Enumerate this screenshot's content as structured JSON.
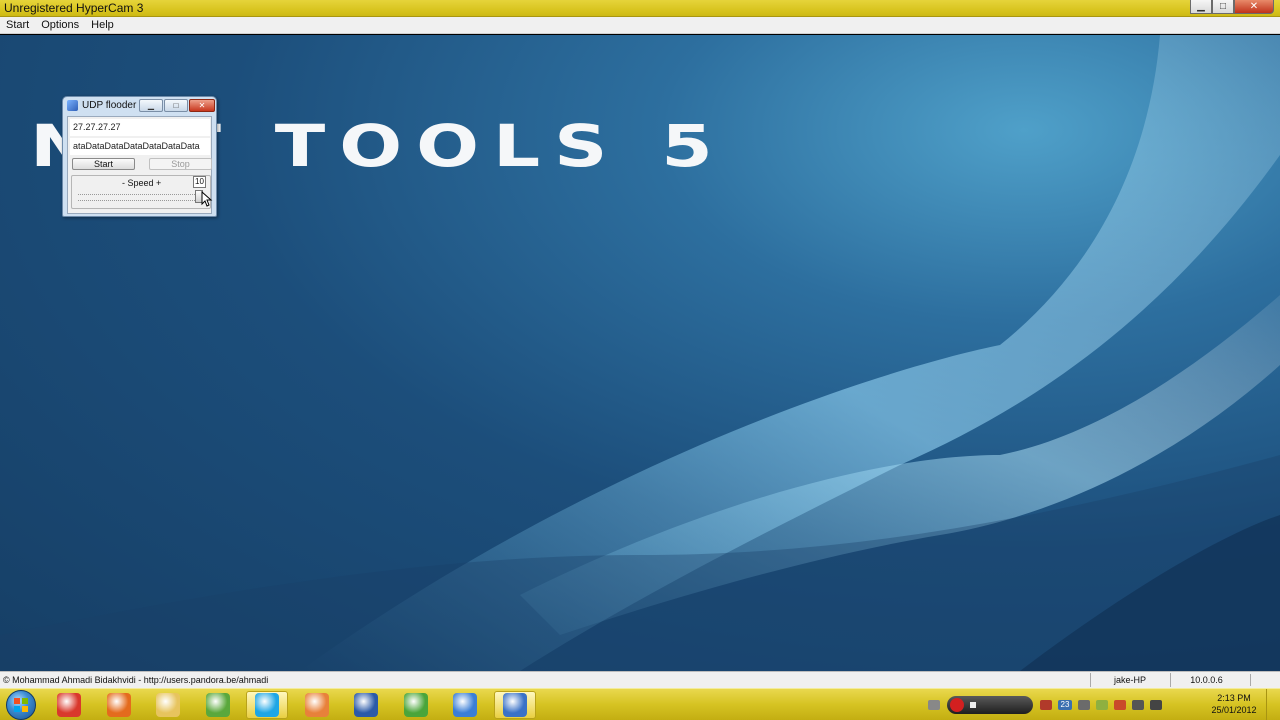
{
  "window": {
    "title": "Unregistered HyperCam 3"
  },
  "menu": {
    "items": [
      "Start",
      "Options",
      "Help"
    ]
  },
  "desktop": {
    "wallpaper_text": "NET TOOLS 5"
  },
  "udp_window": {
    "title": "UDP flooder",
    "ip_value": "27.27.27.27",
    "data_value": "ataDataDataDataDataDataData",
    "start_label": "Start",
    "stop_label": "Stop",
    "speed_label": "- Speed +",
    "speed_value": "10",
    "speed_level_fraction": 1.0
  },
  "statusbar": {
    "credit": "© Mohammad Ahmadi Bidakhvidi - http://users.pandora.be/ahmadi",
    "host": "jake-HP",
    "version": "10.0.0.6"
  },
  "taskbar": {
    "start_icon": "windows-orb-icon",
    "pinned": [
      {
        "name": "chrome-icon",
        "color": "#d9382c"
      },
      {
        "name": "firefox-icon",
        "color": "#e46b1d"
      },
      {
        "name": "explorer-folder-icon",
        "color": "#e7c45e"
      },
      {
        "name": "network-tool-icon",
        "color": "#5aa83c"
      },
      {
        "name": "skype-icon",
        "color": "#1ea6e5",
        "active": true
      },
      {
        "name": "media-player-icon",
        "color": "#e8813a"
      },
      {
        "name": "word-icon",
        "color": "#2b5aa8"
      },
      {
        "name": "windows-media-icon",
        "color": "#4aa53a"
      },
      {
        "name": "itunes-icon",
        "color": "#3a7ed6"
      },
      {
        "name": "globe-app-icon",
        "color": "#3a72c7",
        "active": true
      }
    ],
    "tray_badge": "23",
    "time": "2:13 PM",
    "date": "25/01/2012"
  }
}
